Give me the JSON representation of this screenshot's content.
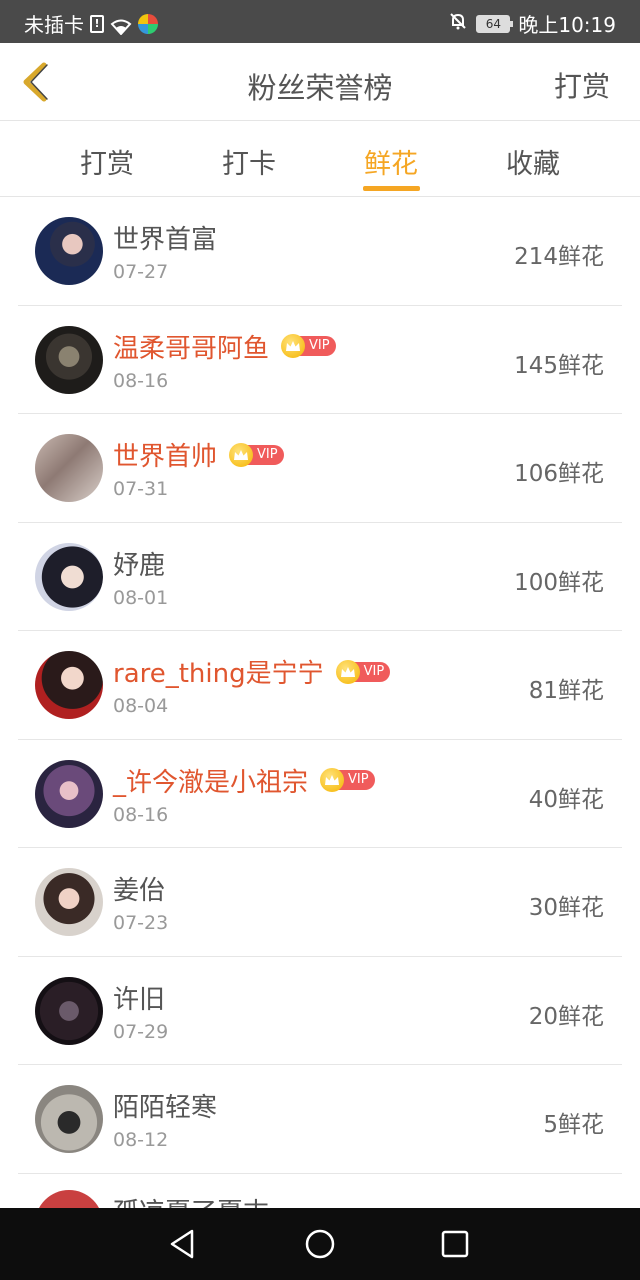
{
  "status_bar": {
    "carrier": "未插卡",
    "sim_icon_text": "!",
    "battery_level": "64",
    "time": "晚上10:19",
    "icons": [
      "sim-alert-icon",
      "wifi-icon",
      "app-notification-icon",
      "mute-bell-icon",
      "battery-icon"
    ]
  },
  "header": {
    "title": "粉丝荣誉榜",
    "action_label": "打赏",
    "back_icon": "chevron-left-icon"
  },
  "tabs": [
    {
      "label": "打赏",
      "active": false
    },
    {
      "label": "打卡",
      "active": false
    },
    {
      "label": "鲜花",
      "active": true
    },
    {
      "label": "收藏",
      "active": false
    }
  ],
  "vip_badge_text": "VIP",
  "list": [
    {
      "name": "世界首富",
      "date": "07-27",
      "amount": "214鲜花",
      "vip": false
    },
    {
      "name": "温柔哥哥阿鱼",
      "date": "08-16",
      "amount": "145鲜花",
      "vip": true
    },
    {
      "name": "世界首帅",
      "date": "07-31",
      "amount": "106鲜花",
      "vip": true
    },
    {
      "name": "妤鹿",
      "date": "08-01",
      "amount": "100鲜花",
      "vip": false
    },
    {
      "name": "rare_thing是宁宁",
      "date": "08-04",
      "amount": "81鲜花",
      "vip": true
    },
    {
      "name": "_许今澈是小祖宗",
      "date": "08-16",
      "amount": "40鲜花",
      "vip": true
    },
    {
      "name": "姜佁",
      "date": "07-23",
      "amount": "30鲜花",
      "vip": false
    },
    {
      "name": "许旧",
      "date": "07-29",
      "amount": "20鲜花",
      "vip": false
    },
    {
      "name": "陌陌轻寒",
      "date": "08-12",
      "amount": "5鲜花",
      "vip": false
    }
  ],
  "partial_item": {
    "name": "孤凉夏了夏末"
  },
  "colors": {
    "accent": "#f5a623",
    "vip_name": "#e0562f",
    "vip_badge": "#f05b5b",
    "status_bar": "#4a4a4a",
    "nav_bar": "#0d0d0d"
  }
}
